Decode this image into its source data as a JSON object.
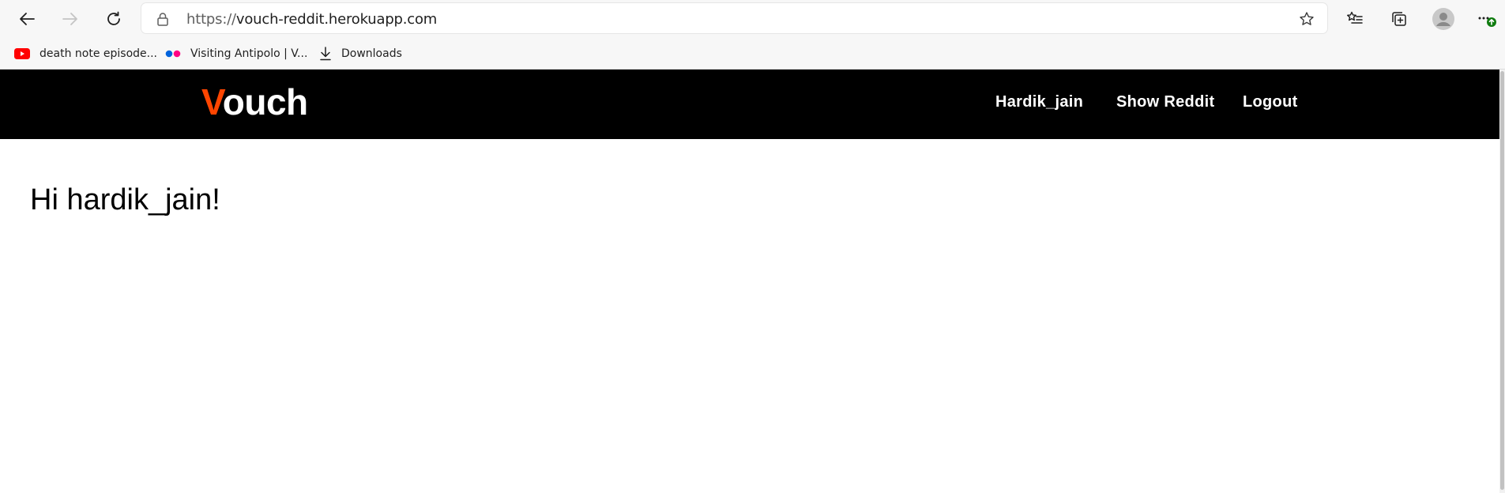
{
  "browser": {
    "nav": {
      "back_icon": "back-arrow-icon",
      "forward_icon": "forward-arrow-icon",
      "refresh_icon": "refresh-icon"
    },
    "address_bar": {
      "scheme": "https://",
      "host": "vouch-reddit.herokuapp.com",
      "lock_icon": "lock-icon",
      "favorite_icon": "star-icon"
    },
    "toolbar_icons": [
      "favorites-list-icon",
      "collections-icon",
      "profile-avatar-icon",
      "more-menu-icon"
    ],
    "update_badge_color": "#107c10",
    "bookmarks": [
      {
        "label": "death note episode...",
        "icon": "youtube-icon"
      },
      {
        "label": "Visiting Antipolo | V...",
        "icon": "flickr-icon"
      },
      {
        "label": "Downloads",
        "icon": "download-icon"
      }
    ]
  },
  "site": {
    "brand": {
      "first_letter": "V",
      "rest": "ouch",
      "accent_color": "#ff4500",
      "text_color": "#ffffff"
    },
    "nav_background": "#000000",
    "nav_links": [
      {
        "label": "Hardik_jain"
      },
      {
        "label": "Show Reddit"
      },
      {
        "label": "Logout"
      }
    ]
  },
  "main": {
    "greeting": "Hi hardik_jain!"
  }
}
